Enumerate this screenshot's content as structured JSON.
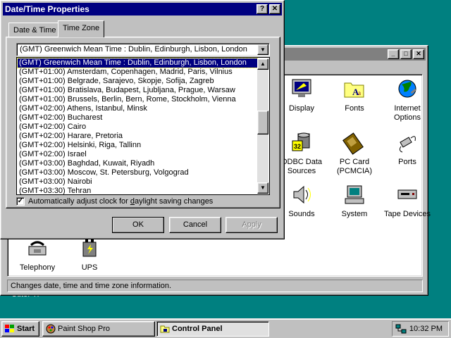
{
  "desktop": {
    "cuteftp_label": "CuteFTP"
  },
  "control_panel": {
    "items": [
      {
        "label": "Display"
      },
      {
        "label": "Fonts"
      },
      {
        "label": "Internet\nOptions"
      },
      {
        "label": "ODBC Data\nSources"
      },
      {
        "label": "PC Card\n(PCMCIA)"
      },
      {
        "label": "Ports"
      },
      {
        "label": "Sounds"
      },
      {
        "label": "System"
      },
      {
        "label": "Tape Devices"
      },
      {
        "label": "Telephony"
      },
      {
        "label": "UPS"
      }
    ],
    "status": "Changes date, time and time zone information."
  },
  "dialog": {
    "title": "Date/Time Properties",
    "tabs": [
      "Date & Time",
      "Time Zone"
    ],
    "combo_value": "(GMT) Greenwich Mean Time : Dublin, Edinburgh, Lisbon, London",
    "options": [
      "(GMT) Greenwich Mean Time : Dublin, Edinburgh, Lisbon, London",
      "(GMT+01:00) Amsterdam, Copenhagen, Madrid, Paris, Vilnius",
      "(GMT+01:00) Belgrade, Sarajevo, Skopje, Sofija, Zagreb",
      "(GMT+01:00) Bratislava, Budapest, Ljubljana, Prague, Warsaw",
      "(GMT+01:00) Brussels, Berlin, Bern, Rome, Stockholm, Vienna",
      "(GMT+02:00) Athens, Istanbul, Minsk",
      "(GMT+02:00) Bucharest",
      "(GMT+02:00) Cairo",
      "(GMT+02:00) Harare, Pretoria",
      "(GMT+02:00) Helsinki, Riga, Tallinn",
      "(GMT+02:00) Israel",
      "(GMT+03:00) Baghdad, Kuwait, Riyadh",
      "(GMT+03:00) Moscow, St. Petersburg, Volgograd",
      "(GMT+03:00) Nairobi",
      "(GMT+03:30) Tehran"
    ],
    "dst_checked": true,
    "dst_label_pre": "Automatically adjust clock for ",
    "dst_label_ul": "d",
    "dst_label_post": "aylight saving changes",
    "buttons": {
      "ok": "OK",
      "cancel": "Cancel",
      "apply": "Apply"
    }
  },
  "taskbar": {
    "start": "Start",
    "items": [
      "Paint Shop Pro",
      "Control Panel"
    ],
    "clock": "10:32 PM"
  },
  "colors": {
    "desktop": "#008080",
    "title_active": "#000080",
    "title_inactive": "#808080",
    "face": "#c0c0c0"
  }
}
